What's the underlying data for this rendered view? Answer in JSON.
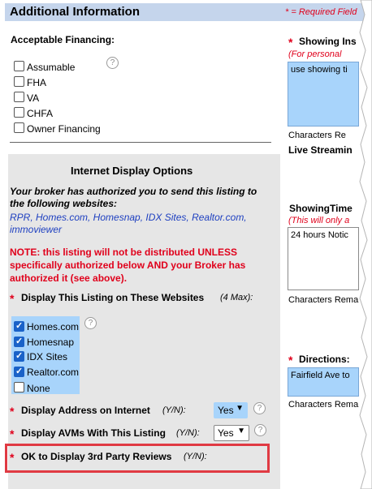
{
  "header": {
    "title": "Additional Information",
    "required_note": "* = Required Field"
  },
  "financing": {
    "label": "Acceptable Financing:",
    "options": [
      {
        "label": "Assumable",
        "checked": false
      },
      {
        "label": "FHA",
        "checked": false
      },
      {
        "label": "VA",
        "checked": false
      },
      {
        "label": "CHFA",
        "checked": false
      },
      {
        "label": "Owner Financing",
        "checked": false
      }
    ]
  },
  "idx": {
    "title": "Internet Display Options",
    "authorized_text": [
      "Your broker has authorized you to send this listing to",
      "the following websites:"
    ],
    "sites_text": [
      "RPR, Homes.com, Homesnap, IDX Sites, Realtor.com,",
      "immoviewer"
    ],
    "note": [
      "NOTE: this listing will not be distributed UNLESS",
      "specifically authorized below AND your Broker has",
      "authorized it (see above)."
    ],
    "websites_label": "Display This Listing on These Websites",
    "websites_max": "(4 Max):",
    "sites": [
      {
        "label": "Homes.com",
        "checked": true
      },
      {
        "label": "Homesnap",
        "checked": true
      },
      {
        "label": "IDX Sites",
        "checked": true
      },
      {
        "label": "Realtor.com",
        "checked": true
      },
      {
        "label": "None",
        "checked": false
      }
    ],
    "address_label": "Display Address on Internet",
    "address_yn": "(Y/N):",
    "address_value": "Yes",
    "avm_label": "Display AVMs With This Listing",
    "avm_yn": "(Y/N):",
    "avm_value": "Yes",
    "reviews_label": "OK to Display 3rd Party Reviews",
    "reviews_yn": "(Y/N):"
  },
  "right": {
    "showing_instructions_label": "Showing Ins",
    "showing_instructions_hint": "(For personal",
    "showing_instructions_value": "use showing ti",
    "chars_remaining_1": "Characters Re",
    "live_streaming": "Live Streamin",
    "showingtime_label": "ShowingTime",
    "showingtime_hint": "(This will only a",
    "showingtime_value": "24 hours Notic",
    "chars_remaining_2": "Characters Rema",
    "directions_label": "Directions:",
    "directions_value": "Fairfield Ave to",
    "chars_remaining_3": "Characters Rema"
  },
  "required_marker": "*",
  "help_icon_glyph": "?",
  "colors": {
    "header_bg": "#c5d5ec",
    "required_red": "#e0001b",
    "link_blue": "#1d3fc0",
    "highlight_blue": "#a8d4fb",
    "panel_gray": "#e6e6e6"
  }
}
